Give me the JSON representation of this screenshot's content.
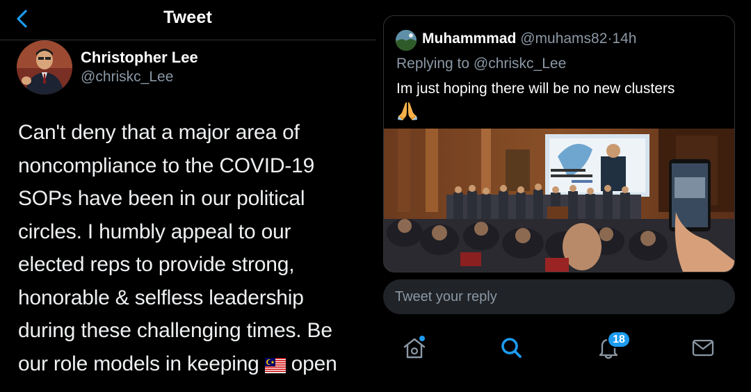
{
  "header": {
    "title": "Tweet"
  },
  "tweet": {
    "author_name": "Christopher Lee",
    "author_handle": "@chriskc_Lee",
    "lines": [
      "Can't deny that a major area of",
      "noncompliance to the COVID-19",
      "SOPs have been in our political",
      "circles. I humbly appeal to our",
      "elected reps to provide strong,",
      "honorable & selfless leadership",
      "during these challenging times. Be"
    ],
    "last_line_before_flag": "our role models in keeping",
    "last_line_after_flag": "open",
    "flag_icon": "malaysia-flag-emoji"
  },
  "reply": {
    "name": "Muhammmad",
    "handle": "@muhams82",
    "separator": "·",
    "time": "14h",
    "replying_to": "Replying to @chriskc_Lee",
    "text": "Im just hoping there will be no new clusters",
    "emoji_icon": "folded-hands-emoji",
    "photo_icon": "press-conference-crowd-photo"
  },
  "reply_input": {
    "placeholder": "Tweet your reply"
  },
  "nav": {
    "items": [
      "home-icon",
      "search-icon",
      "notifications-icon",
      "messages-icon"
    ],
    "notification_count": "18"
  },
  "colors": {
    "background": "#000000",
    "accent": "#1d9bf0",
    "secondary_text": "#8b98a5",
    "border": "#2f3336",
    "input_bg": "#202327"
  }
}
